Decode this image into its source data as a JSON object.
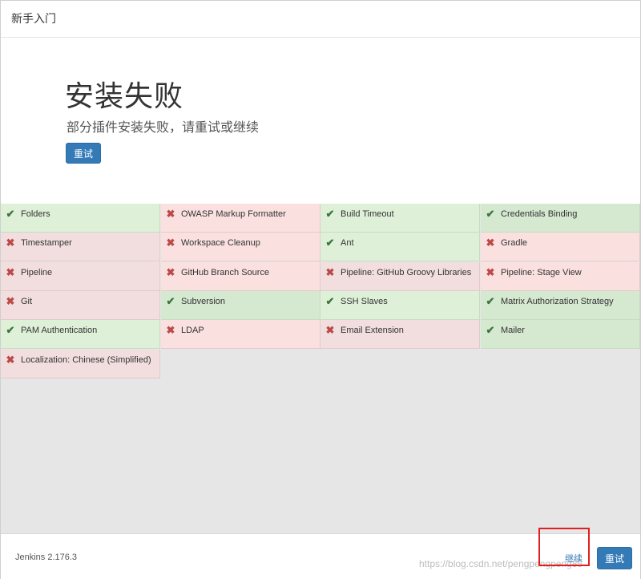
{
  "header": {
    "title": "新手入门"
  },
  "hero": {
    "title": "安装失败",
    "subtitle": "部分插件安装失败，请重试或继续",
    "retry_label": "重试"
  },
  "status_icons": {
    "ok": "✔",
    "fail": "✖"
  },
  "plugins": [
    {
      "name": "Folders",
      "status": "ok"
    },
    {
      "name": "OWASP Markup Formatter",
      "status": "fail"
    },
    {
      "name": "Build Timeout",
      "status": "ok"
    },
    {
      "name": "Credentials Binding",
      "status": "ok"
    },
    {
      "name": "Timestamper",
      "status": "fail"
    },
    {
      "name": "Workspace Cleanup",
      "status": "fail"
    },
    {
      "name": "Ant",
      "status": "ok"
    },
    {
      "name": "Gradle",
      "status": "fail"
    },
    {
      "name": "Pipeline",
      "status": "fail"
    },
    {
      "name": "GitHub Branch Source",
      "status": "fail"
    },
    {
      "name": "Pipeline: GitHub Groovy Libraries",
      "status": "fail"
    },
    {
      "name": "Pipeline: Stage View",
      "status": "fail"
    },
    {
      "name": "Git",
      "status": "fail"
    },
    {
      "name": "Subversion",
      "status": "ok"
    },
    {
      "name": "SSH Slaves",
      "status": "ok"
    },
    {
      "name": "Matrix Authorization Strategy",
      "status": "ok"
    },
    {
      "name": "PAM Authentication",
      "status": "ok"
    },
    {
      "name": "LDAP",
      "status": "fail"
    },
    {
      "name": "Email Extension",
      "status": "fail"
    },
    {
      "name": "Mailer",
      "status": "ok"
    },
    {
      "name": "Localization: Chinese (Simplified)",
      "status": "fail"
    }
  ],
  "footer": {
    "version": "Jenkins 2.176.3",
    "continue_label": "继续",
    "retry_label": "重试",
    "watermark": "https://blog.csdn.net/pengpengpeng85"
  },
  "colors": {
    "primary": "#337ab7",
    "ok_bg": "#dff0d8",
    "fail_bg": "#f2dede",
    "highlight": "#e02020"
  }
}
